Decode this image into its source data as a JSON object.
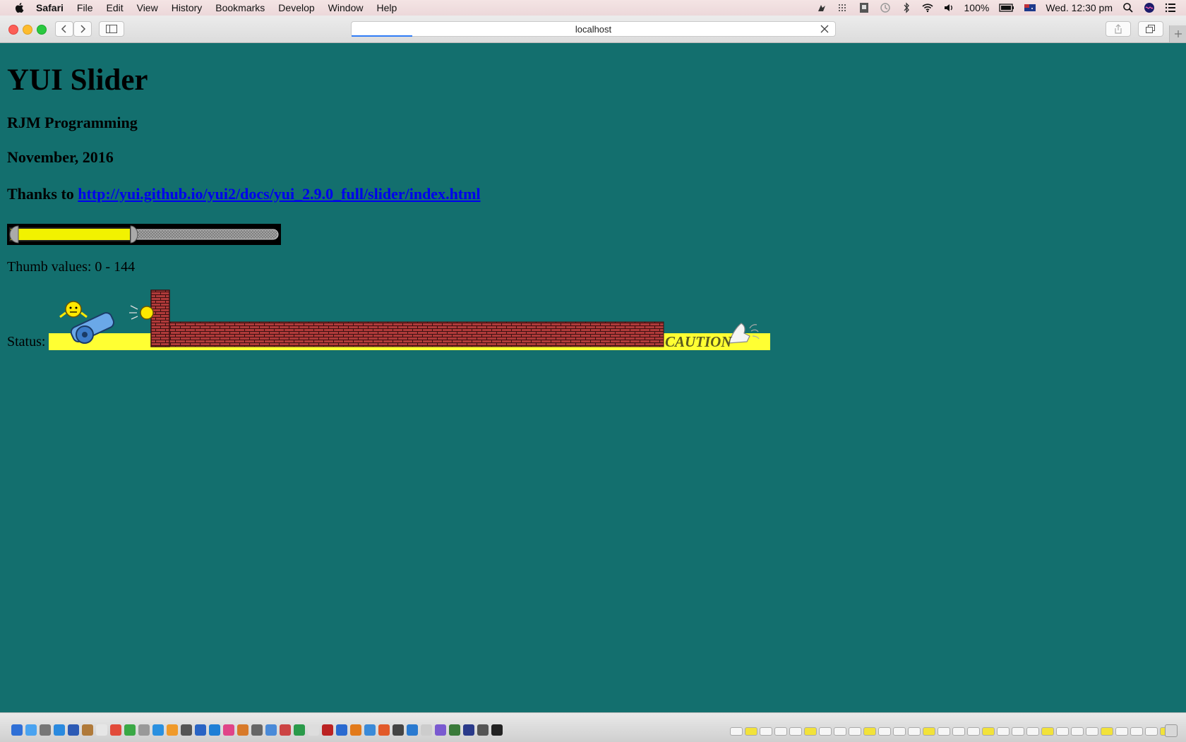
{
  "menubar": {
    "app_name": "Safari",
    "items": [
      "File",
      "Edit",
      "View",
      "History",
      "Bookmarks",
      "Develop",
      "Window",
      "Help"
    ],
    "battery": "100%",
    "clock": "Wed. 12:30 pm"
  },
  "browser": {
    "address": "localhost"
  },
  "page": {
    "title": "YUI Slider",
    "author": "RJM Programming",
    "date": "November, 2016",
    "thanks_prefix": "Thanks to",
    "thanks_link": "http://yui.github.io/yui2/docs/yui_2.9.0_full/slider/index.html",
    "thumb_values": "Thumb values: 0 - 144",
    "status_label": "Status:",
    "caution_text": "CAUTION"
  },
  "slider": {
    "fill_fraction": 0.45
  },
  "colors": {
    "page_background": "#136f6e",
    "slider_fill": "#ffff00",
    "status_background": "#ffff33",
    "brick": "#b03a3a",
    "link": "#0000ee"
  },
  "icons": {
    "apple": "apple-icon",
    "cannon": "cannon-icon",
    "wall": "brick-wall-icon",
    "pointer": "hand-pointer-icon"
  }
}
